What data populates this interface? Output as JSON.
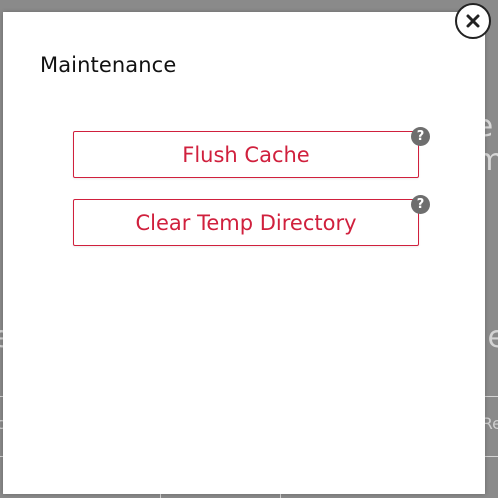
{
  "modal": {
    "title": "Maintenance",
    "actions": [
      {
        "label": "Flush Cache",
        "help_glyph": "?"
      },
      {
        "label": "Clear Temp Directory",
        "help_glyph": "?"
      }
    ],
    "close_icon": "close-icon"
  },
  "background": {
    "right_top_fragment": "e\nm",
    "left_mid_fragment": "e",
    "right_mid_fragment": "e",
    "left_low_fragment": "c",
    "right_low_fragment": "Re"
  },
  "colors": {
    "accent": "#d0203d",
    "help_icon": "#6e6e6e",
    "text": "#111111"
  }
}
